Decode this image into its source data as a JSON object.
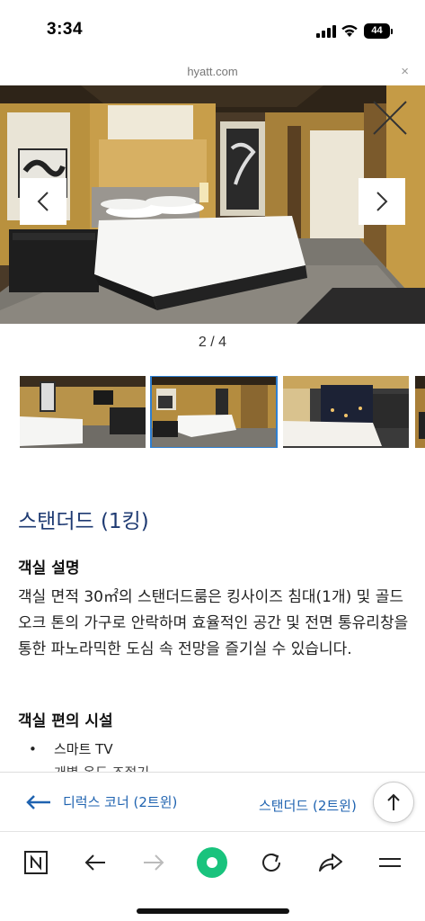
{
  "status_bar": {
    "time": "3:34",
    "battery": "44"
  },
  "url_bar": {
    "domain": "hyatt.com",
    "close_glyph": "×"
  },
  "gallery": {
    "counter": "2 / 4"
  },
  "room": {
    "title": "스탠더드 (1킹)",
    "description_heading": "객실 설명",
    "description": "객실 면적 30㎡의 스탠더드룸은 킹사이즈 침대(1개) 및 골드 오크 톤의 가구로 안락하며 효율적인 공간 및 전면 통유리창을 통한 파노라믹한 도심 속 전망을 즐기실 수 있습니다.",
    "amenities_heading": "객실 편의 시설",
    "amenities": [
      "스마트 TV",
      "개별 온도 조절기"
    ]
  },
  "room_nav": {
    "prev_label": "디럭스 코너 (2트윈)",
    "next_label": "스탠더드 (2트윈) "
  },
  "icons": {
    "status": [
      "signal-icon",
      "wifi-icon",
      "battery-icon"
    ],
    "gallery": [
      "chevron-left-icon",
      "chevron-right-icon",
      "close-icon"
    ],
    "nav": [
      "arrow-left-icon",
      "arrow-up-icon"
    ],
    "toolbar": [
      "naver-logo-icon",
      "back-arrow-icon",
      "forward-arrow-icon",
      "green-dot-icon",
      "reload-icon",
      "share-icon",
      "menu-icon"
    ]
  },
  "colors": {
    "title": "#1e3a72",
    "link": "#1f63b0",
    "accent_green": "#19c37d",
    "thumb_selected": "#2f7fd0"
  }
}
